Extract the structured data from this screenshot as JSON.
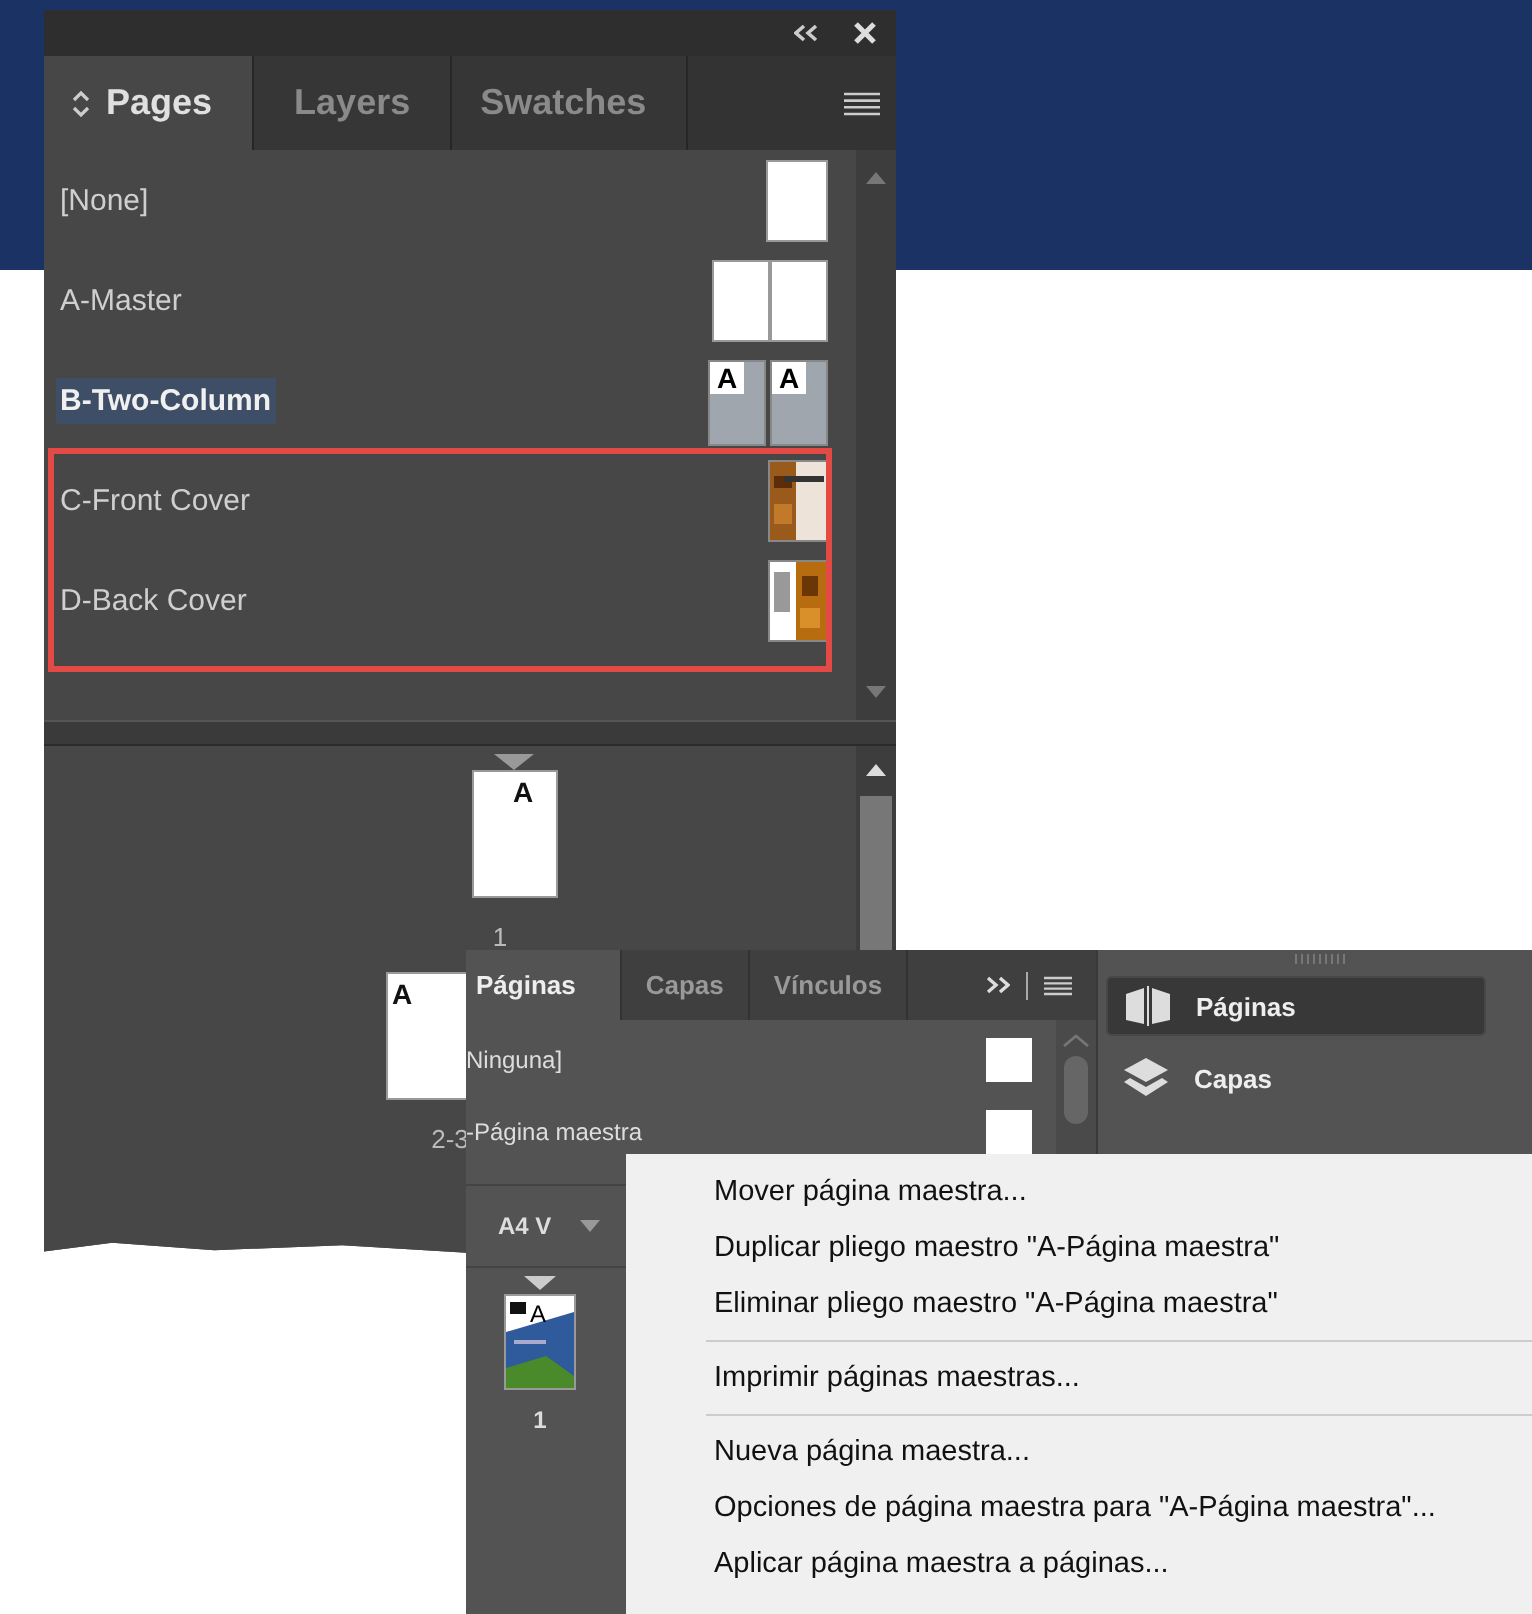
{
  "pages_panel": {
    "tabs": [
      {
        "label": "Pages",
        "selected": true
      },
      {
        "label": "Layers",
        "selected": false
      },
      {
        "label": "Swatches",
        "selected": false
      }
    ],
    "masters": [
      {
        "name": "[None]",
        "selected": false,
        "marked": false,
        "kind": "single"
      },
      {
        "name": "A-Master",
        "selected": false,
        "marked": false,
        "kind": "spread"
      },
      {
        "name": "B-Two-Column",
        "selected": true,
        "marked": false,
        "kind": "lettered",
        "letters": [
          "A",
          "A"
        ]
      },
      {
        "name": "C-Front Cover",
        "selected": false,
        "marked": true,
        "kind": "front"
      },
      {
        "name": "D-Back Cover",
        "selected": false,
        "marked": true,
        "kind": "back"
      }
    ],
    "pages": [
      {
        "label": "1",
        "kind": "single",
        "master": "A"
      },
      {
        "label": "2-3",
        "kind": "spread",
        "master": "A"
      }
    ]
  },
  "paginas_panel": {
    "tabs": [
      {
        "label": "Páginas",
        "selected": true
      },
      {
        "label": "Capas",
        "selected": false
      },
      {
        "label": "Vínculos",
        "selected": false
      }
    ],
    "masters": [
      {
        "name": "Ninguna]"
      },
      {
        "name": "-Página maestra"
      }
    ],
    "page_size": "A4 V",
    "pages": [
      {
        "label": "1",
        "master": "A"
      }
    ]
  },
  "dock": {
    "items": [
      {
        "label": "Páginas",
        "kind": "pages",
        "selected": true
      },
      {
        "label": "Capas",
        "kind": "layers",
        "selected": false
      }
    ]
  },
  "context_menu": {
    "groups": [
      [
        "Mover página maestra...",
        "Duplicar pliego maestro \"A-Página maestra\"",
        "Eliminar pliego maestro \"A-Página maestra\""
      ],
      [
        "Imprimir páginas maestras..."
      ],
      [
        "Nueva página maestra...",
        "Opciones de página maestra para \"A-Página maestra\"...",
        "Aplicar página maestra a páginas..."
      ]
    ]
  }
}
